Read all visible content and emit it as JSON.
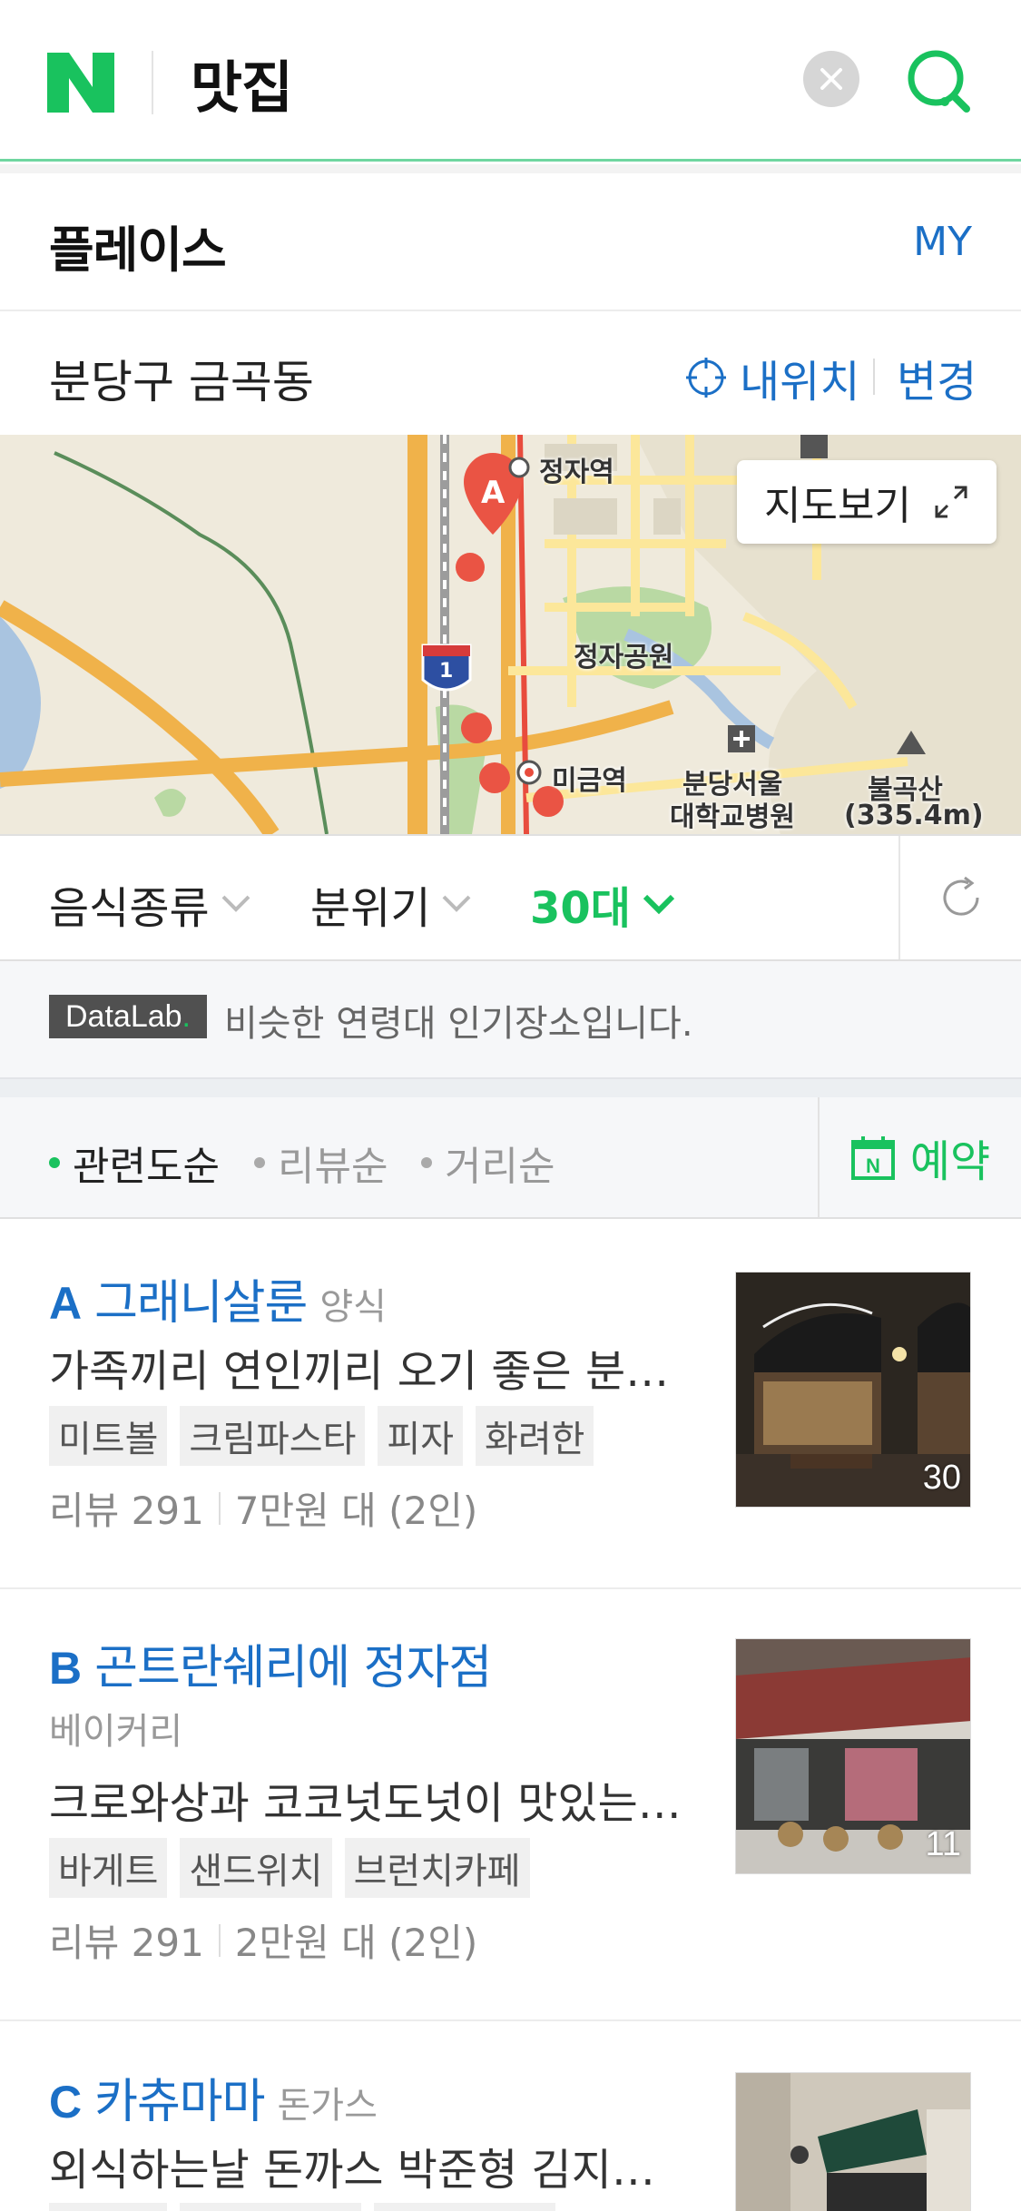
{
  "header": {
    "logo_letter": "N",
    "query": "맛집",
    "brand_color": "#19c25e"
  },
  "place_bar": {
    "title": "플레이스",
    "my_label": "MY"
  },
  "location": {
    "name": "분당구 금곡동",
    "my_position_label": "내위치",
    "change_label": "변경"
  },
  "map": {
    "view_button_label": "지도보기",
    "marker_label": "A",
    "route_number": "1",
    "place_labels": [
      "정자역",
      "정자공원",
      "미금역",
      "분당서울",
      "대학교병원",
      "불곡산",
      "(335.4m)"
    ]
  },
  "filters": [
    {
      "label": "음식종류",
      "active": false
    },
    {
      "label": "분위기",
      "active": false
    },
    {
      "label": "30대",
      "active": true
    }
  ],
  "notice": {
    "badge": "DataLab",
    "badge_dot": ".",
    "text": "비슷한 연령대 인기장소입니다."
  },
  "sort": {
    "options": [
      "관련도순",
      "리뷰순",
      "거리순"
    ],
    "active": "관련도순",
    "reserve_label": "예약",
    "reserve_icon_letter": "N"
  },
  "results": [
    {
      "letter": "A",
      "name": "그래니살룬",
      "category": "양식",
      "description": "가족끼리 연인끼리 오기 좋은 분…",
      "tags": [
        "미트볼",
        "크림파스타",
        "피자",
        "화려한"
      ],
      "reviews": "리뷰 291",
      "price": "7만원 대 (2인)",
      "photo_count": "30"
    },
    {
      "letter": "B",
      "name": "곤트란쉐리에 정자점",
      "category": "베이커리",
      "description": "크로와상과 코코넛도넛이 맛있는…",
      "tags": [
        "바게트",
        "샌드위치",
        "브런치카페"
      ],
      "reviews": "리뷰 291",
      "price": "2만원 대 (2인)",
      "photo_count": "11"
    },
    {
      "letter": "C",
      "name": "카츄마마",
      "category": "돈가스",
      "description": "외식하는날 돈까스 박준형 김지…",
      "tags": [],
      "reviews": "",
      "price": "",
      "photo_count": ""
    }
  ]
}
